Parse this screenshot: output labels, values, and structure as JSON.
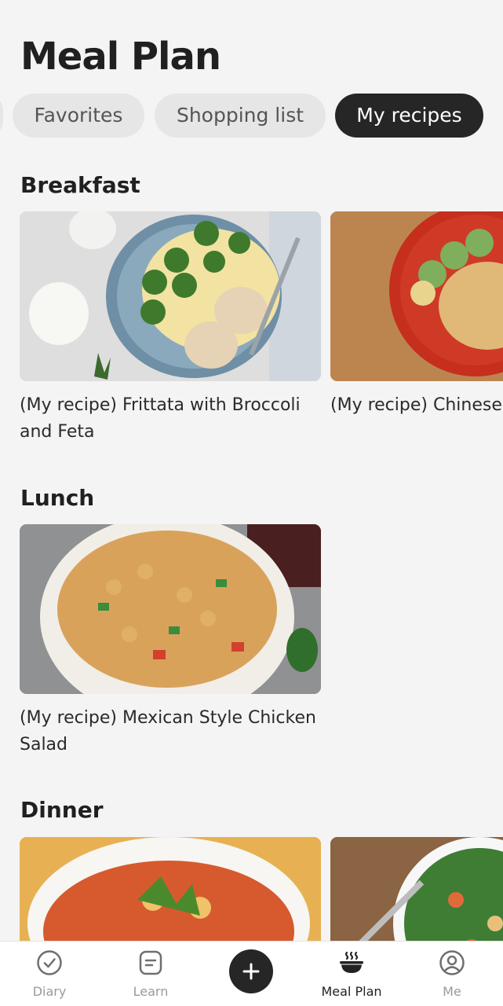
{
  "header": {
    "title": "Meal Plan"
  },
  "chips": [
    {
      "label": "Favorites",
      "active": false
    },
    {
      "label": "Shopping list",
      "active": false
    },
    {
      "label": "My recipes",
      "active": true
    }
  ],
  "sections": {
    "breakfast": {
      "title": "Breakfast",
      "cards": [
        {
          "title": "(My recipe) Frittata with Broccoli and Feta"
        },
        {
          "title": "(My recipe) Chinese Omelet"
        }
      ]
    },
    "lunch": {
      "title": "Lunch",
      "cards": [
        {
          "title": "(My recipe) Mexican Style Chicken Salad"
        }
      ]
    },
    "dinner": {
      "title": "Dinner"
    }
  },
  "bottom_nav": {
    "items": [
      {
        "label": "Diary",
        "icon": "check-circle-icon",
        "active": false
      },
      {
        "label": "Learn",
        "icon": "document-icon",
        "active": false
      },
      {
        "label": "",
        "icon": "plus-icon",
        "active": false
      },
      {
        "label": "Meal Plan",
        "icon": "bowl-icon",
        "active": true
      },
      {
        "label": "Me",
        "icon": "user-circle-icon",
        "active": false
      }
    ]
  },
  "colors": {
    "background": "#f4f4f4",
    "chip_active": "#262626",
    "chip_inactive": "#e6e6e6"
  }
}
